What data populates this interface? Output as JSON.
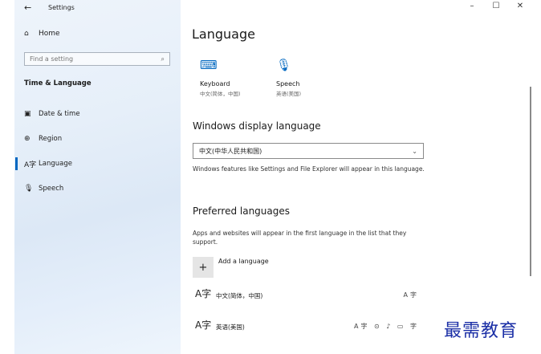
{
  "window": {
    "title": "Settings",
    "back_icon": "arrow-left-icon",
    "controls": {
      "minimize": "–",
      "maximize": "☐",
      "close": "✕"
    }
  },
  "sidebar": {
    "home_label": "Home",
    "search_placeholder": "Find a setting",
    "section_title": "Time & Language",
    "items": [
      {
        "label": "Date & time",
        "icon": "calendar-clock-icon"
      },
      {
        "label": "Region",
        "icon": "globe-icon"
      },
      {
        "label": "Language",
        "icon": "language-icon",
        "selected": true
      },
      {
        "label": "Speech",
        "icon": "microphone-icon"
      }
    ]
  },
  "main": {
    "title": "Language",
    "quick_links": [
      {
        "label": "Keyboard",
        "sub": "中文(简体，中国)",
        "icon": "keyboard-icon"
      },
      {
        "label": "Speech",
        "sub": "英语(美国)",
        "icon": "microphone-icon"
      }
    ],
    "display_language": {
      "heading": "Windows display language",
      "selected": "中文(中华人民共和国)",
      "description": "Windows features like Settings and File Explorer will appear in this language."
    },
    "preferred": {
      "heading": "Preferred languages",
      "description": "Apps and websites will appear in the first language in the list that they support.",
      "add_label": "Add a language",
      "languages": [
        {
          "name": "中文(简体，中国)",
          "features": "A字"
        },
        {
          "name": "英语(美国)",
          "features": "A字 ⊙ ♪ ▭ 字"
        }
      ]
    }
  },
  "watermark": "最需教育",
  "colors": {
    "accent": "#0067c0",
    "watermark": "#1b2fa6"
  }
}
